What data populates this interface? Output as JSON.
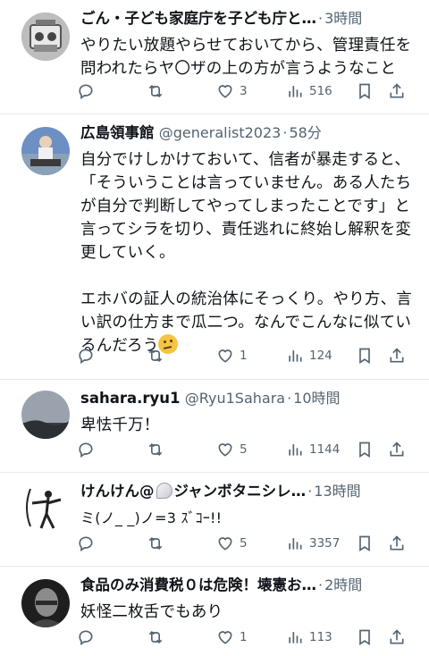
{
  "tweets": [
    {
      "name": "ごん・子ども家庭庁を子ども庁と…",
      "handle": "",
      "time": "3時間",
      "text": "やりたい放題やらせておいてから、管理責任を\n問われたらヤ〇ザの上の方が言うようなこと",
      "replies": "",
      "retweets": "",
      "likes": "3",
      "views": "516",
      "avatar_icon": "robot-figure-avatar"
    },
    {
      "name": "広島領事館",
      "handle": "@generalist2023",
      "time": "58分",
      "text": "自分でけしかけておいて、信者が暴走すると、\n「そういうことは言っていません。ある人たち\nが自分で判断してやってしまったことです」と\n言ってシラを切り、責任逃れに終始し解釈を変\n更していく。\n\nエホバの証人の統治体にそっくり。やり方、言\nい訳の仕方まで瓜二つ。なんでこんなに似てい\nるんだろう",
      "emoji": "thinking-face",
      "replies": "",
      "retweets": "",
      "likes": "1",
      "views": "124",
      "avatar_icon": "rider-avatar"
    },
    {
      "name": "sahara.ryu1",
      "handle": "@Ryu1Sahara",
      "time": "10時間",
      "text": "卑怯千万！",
      "replies": "",
      "retweets": "",
      "likes": "5",
      "views": "1144",
      "avatar_icon": "sky-avatar"
    },
    {
      "name_a": "けんけん@",
      "name_b": "ジャンボタニシレ…",
      "handle": "",
      "time": "13時間",
      "text": "ミ(ノ_ _)ノ=3 ｽﾞｺｰ!!",
      "replies": "",
      "retweets": "",
      "likes": "5",
      "views": "3357",
      "avatar_icon": "archer-avatar"
    },
    {
      "name": "食品のみ消費税０は危険！壊憲お…",
      "handle": "",
      "time": "2時間",
      "text": "妖怪二枚舌でもあり",
      "replies": "",
      "retweets": "",
      "likes": "1",
      "views": "113",
      "avatar_icon": "man-portrait-avatar"
    }
  ],
  "separator": "·"
}
